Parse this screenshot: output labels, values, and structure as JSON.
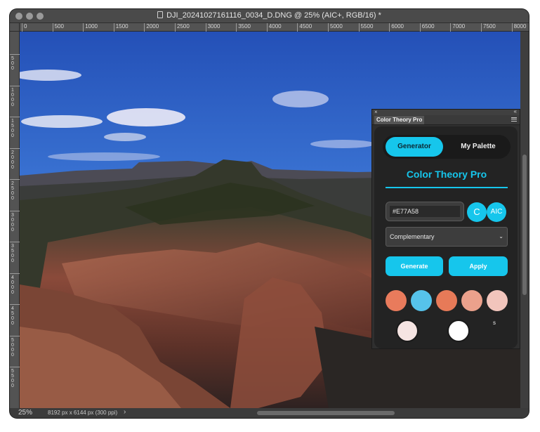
{
  "window": {
    "title": "DJI_20241027161116_0034_D.DNG @ 25% (AIC+, RGB/16) *"
  },
  "ruler": {
    "horizontal": [
      "0",
      "500",
      "1000",
      "1500",
      "2000",
      "2500",
      "3000",
      "3500",
      "4000",
      "4500",
      "5000",
      "5500",
      "6000",
      "6500",
      "7000",
      "7500",
      "8000"
    ],
    "vertical": [
      "5\n0\n0",
      "1\n0\n0\n0",
      "1\n5\n0\n0",
      "2\n0\n0\n0",
      "2\n5\n0\n0",
      "3\n0\n0\n0",
      "3\n5\n0\n0",
      "4\n0\n0\n0",
      "4\n5\n0\n0",
      "5\n0\n0\n0",
      "5\n5\n0\n0"
    ]
  },
  "status": {
    "zoom": "25%",
    "doc_info": "8192 px x 6144 px (300 ppi)",
    "arrow": "›"
  },
  "panel": {
    "close_glyph": "×",
    "collapse_glyph": "«",
    "tab_label": "Color Theory Pro",
    "segments": {
      "generator": "Generator",
      "palette": "My Palette"
    },
    "app_title": "Color Theory Pro",
    "hex_value": "#E77A58",
    "circle_c": "C",
    "circle_aic": "AIC",
    "scheme_selected": "Complementary",
    "chevron": "⌄",
    "generate_label": "Generate",
    "apply_label": "Apply",
    "swatch_label": "s",
    "swatches": [
      "#E97B5C",
      "#56C3EB",
      "#E77A58",
      "#EBA18C",
      "#F2C5BC",
      "#F5E4E2",
      "#FFFFFF"
    ]
  },
  "colors": {
    "accent": "#16C6EC"
  }
}
